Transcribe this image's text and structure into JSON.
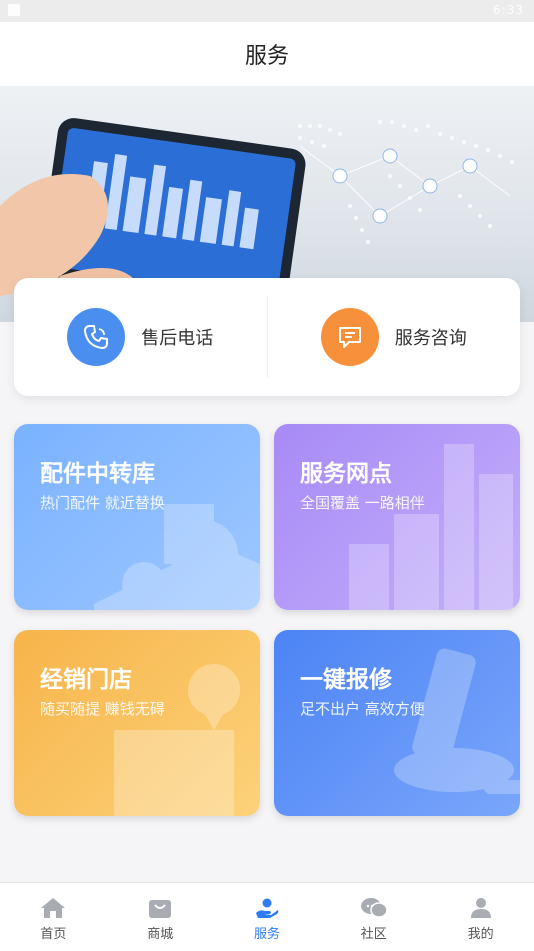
{
  "status_bar": {
    "time": "6:33"
  },
  "header": {
    "title": "服务"
  },
  "contact": {
    "items": [
      {
        "label": "售后电话",
        "icon": "phone-icon",
        "color": "#4a8ef0"
      },
      {
        "label": "服务咨询",
        "icon": "chat-icon",
        "color": "#f7903a"
      }
    ]
  },
  "tiles": [
    {
      "title": "配件中转库",
      "subtitle": "热门配件 就近替换"
    },
    {
      "title": "服务网点",
      "subtitle": "全国覆盖 一路相伴"
    },
    {
      "title": "经销门店",
      "subtitle": "随买随提 赚钱无碍"
    },
    {
      "title": "一键报修",
      "subtitle": "足不出户 高效方便"
    }
  ],
  "tabbar": {
    "active_color": "#2f7cf6",
    "items": [
      {
        "label": "首页",
        "icon": "home-icon"
      },
      {
        "label": "商城",
        "icon": "bag-icon"
      },
      {
        "label": "服务",
        "icon": "service-icon",
        "active": true
      },
      {
        "label": "社区",
        "icon": "community-icon"
      },
      {
        "label": "我的",
        "icon": "user-icon"
      }
    ]
  }
}
